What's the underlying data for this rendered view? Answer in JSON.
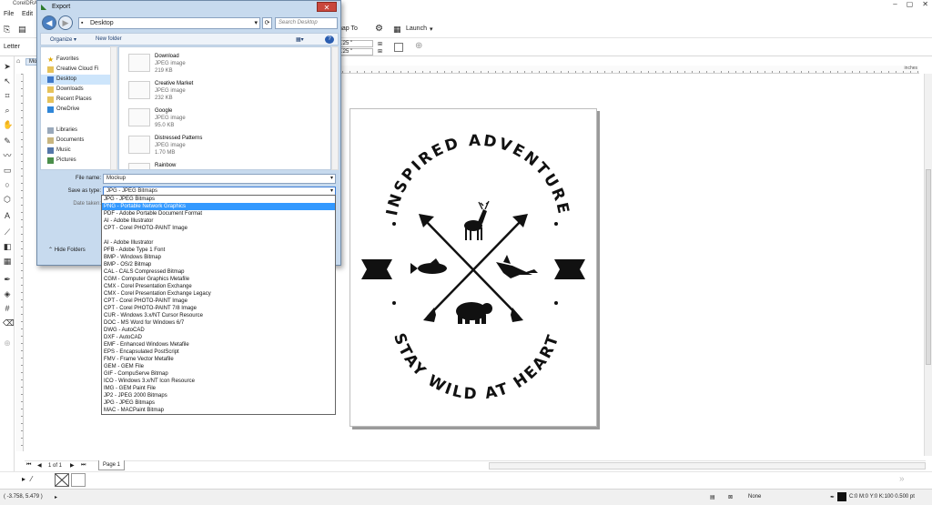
{
  "app": {
    "title": "CorelDRAW",
    "menu": [
      "File",
      "Edit"
    ],
    "toolbar": {
      "snap_label": "nap To",
      "launch_label": "Launch",
      "paper_label": "Letter",
      "nudge1": ".25 \"",
      "nudge2": ".25 \"",
      "units": "inches"
    },
    "doc_tab": "Moc",
    "page_tab": "Page 1",
    "page_counter": "1 of 1",
    "status": {
      "coords": "( -3.758, 5.479 )",
      "fill": "None",
      "outline": "C:0 M:0 Y:0 K:100  0.500 pt"
    }
  },
  "dialog": {
    "title": "Export",
    "close": "✕",
    "back": "◀",
    "forward": "▶",
    "address": "Desktop",
    "search_placeholder": "Search Desktop",
    "organize": "Organize ▾",
    "new_folder": "New folder",
    "help": "?",
    "nav": [
      {
        "label": "Favorites",
        "icon": "star-icon",
        "selected": false
      },
      {
        "label": "Creative Cloud Fi",
        "icon": "folder-icon",
        "selected": false
      },
      {
        "label": "Desktop",
        "icon": "desktop-icon",
        "selected": true
      },
      {
        "label": "Downloads",
        "icon": "folder-icon",
        "selected": false
      },
      {
        "label": "Recent Places",
        "icon": "folder-icon",
        "selected": false
      },
      {
        "label": "OneDrive",
        "icon": "cloud-icon",
        "selected": false
      },
      {
        "label": "Libraries",
        "icon": "library-icon",
        "selected": false
      },
      {
        "label": "Documents",
        "icon": "document-icon",
        "selected": false
      },
      {
        "label": "Music",
        "icon": "music-icon",
        "selected": false
      },
      {
        "label": "Pictures",
        "icon": "picture-icon",
        "selected": false
      }
    ],
    "files": [
      {
        "name": "Download",
        "type": "JPEG image",
        "size": "219 KB"
      },
      {
        "name": "Creative Market",
        "type": "JPEG image",
        "size": "232 KB"
      },
      {
        "name": "Google",
        "type": "JPEG image",
        "size": "95.0 KB"
      },
      {
        "name": "Distressed Patterns",
        "type": "JPEG image",
        "size": "1.70 MB"
      },
      {
        "name": "Rainbow",
        "type": "",
        "size": ""
      }
    ],
    "file_name_label": "File name:",
    "file_name_value": "Mockup",
    "save_type_label": "Save as type:",
    "save_type_value": "JPG - JPEG Bitmaps",
    "date_label": "Date taken:",
    "hide_folders": "Hide Folders",
    "type_options": [
      "JPG - JPEG Bitmaps",
      "PNG - Portable Network Graphics",
      "PDF - Adobe Portable Document Format",
      "AI - Adobe Illustrator",
      "CPT - Corel PHOTO-PAINT Image",
      "",
      "AI - Adobe Illustrator",
      "PFB - Adobe Type 1 Font",
      "BMP - Windows Bitmap",
      "BMP - OS/2 Bitmap",
      "CAL - CALS Compressed Bitmap",
      "CGM - Computer Graphics Metafile",
      "CMX - Corel Presentation Exchange",
      "CMX - Corel Presentation Exchange Legacy",
      "CPT - Corel PHOTO-PAINT Image",
      "CPT - Corel PHOTO-PAINT 7/8 Image",
      "CUR - Windows 3.x/NT Cursor Resource",
      "DOC - MS Word for Windows 6/7",
      "DWG - AutoCAD",
      "DXF - AutoCAD",
      "EMF - Enhanced Windows Metafile",
      "EPS - Encapsulated PostScript",
      "FMV - Frame Vector Metafile",
      "GEM - GEM File",
      "GIF - CompuServe Bitmap",
      "ICO - Windows 3.x/NT Icon Resource",
      "IMG - GEM Paint File",
      "JP2 - JPEG 2000 Bitmaps",
      "JPG - JPEG Bitmaps",
      "MAC - MACPaint Bitmap"
    ],
    "highlighted_option": "PNG - Portable Network Graphics"
  },
  "artwork": {
    "top_text": "INSPIRED ADVENTURE",
    "bottom_text": "STAY WILD AT HEART"
  },
  "colors": {
    "dialog_bg": "#c7daee",
    "highlight": "#3399ff",
    "close_red": "#c9473c",
    "ink": "#111111"
  }
}
